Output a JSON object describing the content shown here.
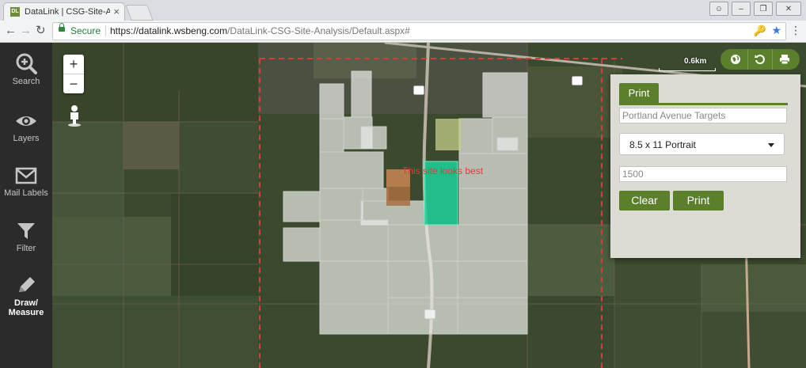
{
  "browser": {
    "tab_title": "DataLink | CSG-Site-Anal",
    "tab_favicon": "DL",
    "secure_label": "Secure",
    "url_host": "https://datalink.wsbeng.com",
    "url_path": "/DataLink-CSG-Site-Analysis/Default.aspx#"
  },
  "sidebar": {
    "items": [
      {
        "label": "Search",
        "icon": "search-plus-icon"
      },
      {
        "label": "Layers",
        "icon": "eye-icon"
      },
      {
        "label": "Mail Labels",
        "icon": "envelope-icon"
      },
      {
        "label": "Filter",
        "icon": "filter-icon"
      },
      {
        "label": "Draw/",
        "label2": "Measure",
        "icon": "pencil-icon",
        "active": true
      }
    ]
  },
  "map": {
    "zoom_in": "+",
    "zoom_out": "−",
    "scale_label": "0.6km",
    "annotation": "This site looks best",
    "tools": [
      "globe-icon",
      "undo-icon",
      "print-icon"
    ]
  },
  "print_panel": {
    "tab_label": "Print",
    "title_placeholder": "Portland Avenue Targets",
    "page_size": "8.5 x 11 Portrait",
    "scale_placeholder": "1500",
    "clear_label": "Clear",
    "print_label": "Print"
  },
  "colors": {
    "accent": "#5c7f2b",
    "annotation": "#e03b3b",
    "selected_parcel": "#1fd19a"
  }
}
